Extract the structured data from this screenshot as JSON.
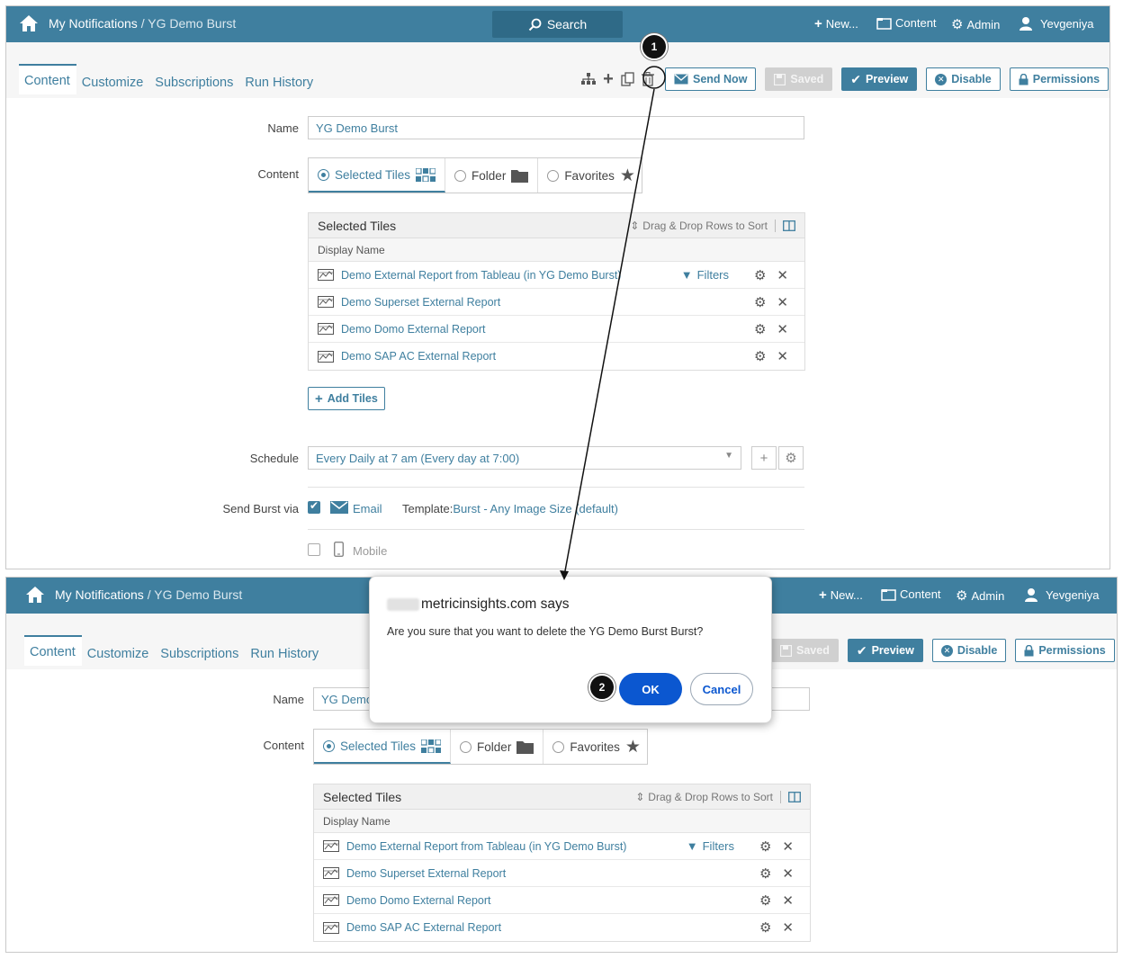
{
  "nav": {
    "breadcrumb_root": "My Notifications",
    "breadcrumb_sep": " / ",
    "breadcrumb_current": "YG Demo Burst",
    "search_label": "Search",
    "new_label": "New...",
    "content_label": "Content",
    "admin_label": "Admin",
    "user_label": "Yevgeniya"
  },
  "tabs": [
    "Content",
    "Customize",
    "Subscriptions",
    "Run History"
  ],
  "toolbar": {
    "send_now": "Send Now",
    "saved": "Saved",
    "preview": "Preview",
    "disable": "Disable",
    "permissions": "Permissions"
  },
  "form": {
    "name_label": "Name",
    "name_value": "YG Demo Burst",
    "name_value_truncated": "YG Demo",
    "content_label": "Content",
    "options": [
      "Selected Tiles",
      "Folder",
      "Favorites"
    ],
    "selected_option": "Selected Tiles"
  },
  "tiles": {
    "title": "Selected Tiles",
    "sort_hint": "Drag & Drop Rows to Sort",
    "column": "Display Name",
    "filters_label": "Filters",
    "rows": [
      "Demo External Report from Tableau (in YG Demo Burst)",
      "Demo Superset External Report",
      "Demo Domo External Report",
      "Demo SAP AC External Report"
    ],
    "add_tiles": "Add Tiles"
  },
  "schedule": {
    "label": "Schedule",
    "value": "Every Daily at 7 am (Every day at 7:00)"
  },
  "send_via": {
    "label": "Send Burst via",
    "email": "Email",
    "template_label": "Template:",
    "template_value": "Burst - Any Image Size (default)",
    "mobile": "Mobile"
  },
  "dialog": {
    "title": "metricinsights.com says",
    "message": "Are you sure that you want to delete the YG Demo Burst Burst?",
    "ok": "OK",
    "cancel": "Cancel"
  },
  "markers": [
    "1",
    "2"
  ],
  "colors": {
    "accent": "#3f7f9f",
    "dialog_ok": "#0b57d0",
    "marker": "#111111"
  }
}
